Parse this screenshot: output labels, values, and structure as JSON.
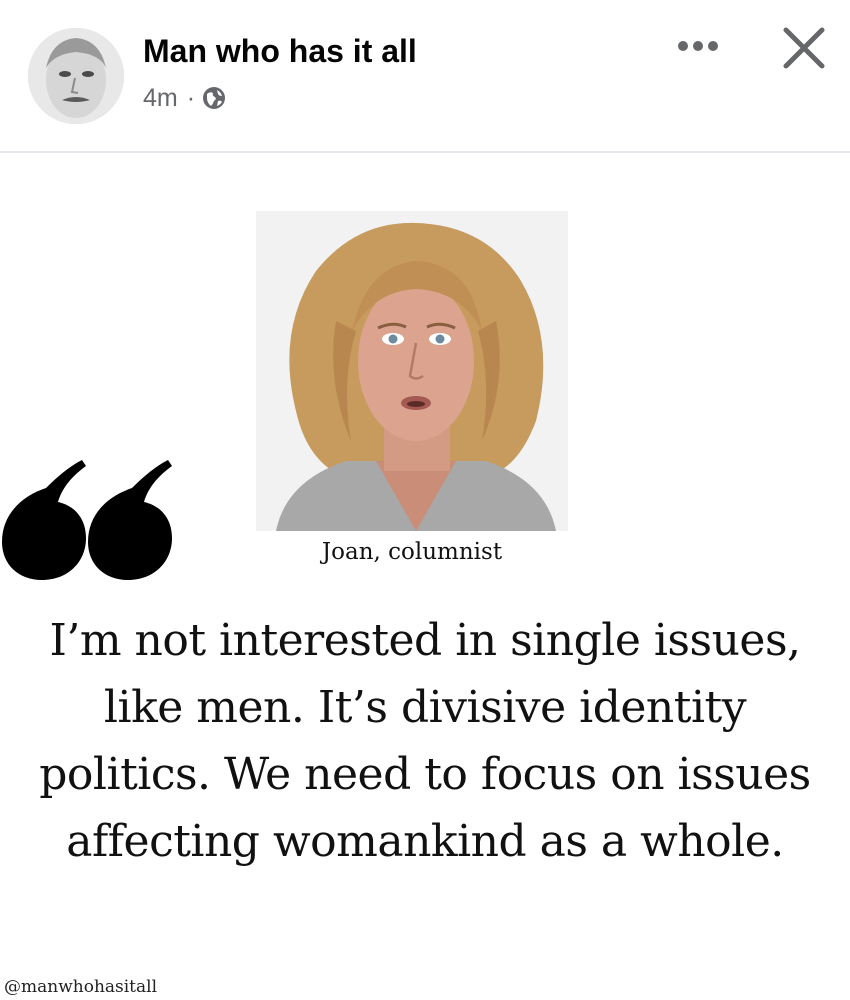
{
  "post": {
    "author_name": "Man who has it all",
    "timestamp": "4m",
    "separator": "·",
    "privacy_icon": "globe-icon",
    "more_icon": "more-dots-icon",
    "close_icon": "close-icon"
  },
  "image": {
    "caption": "Joan, columnist",
    "quote": "I’m not interested in single issues, like men. It’s divisive identity politics. We need to focus on issues affecting womankind as a whole.",
    "watermark": "@manwhohasitall"
  },
  "colors": {
    "text_primary": "#050505",
    "text_secondary": "#65676b",
    "divider": "#e4e6eb",
    "quote_mark": "#000000"
  }
}
